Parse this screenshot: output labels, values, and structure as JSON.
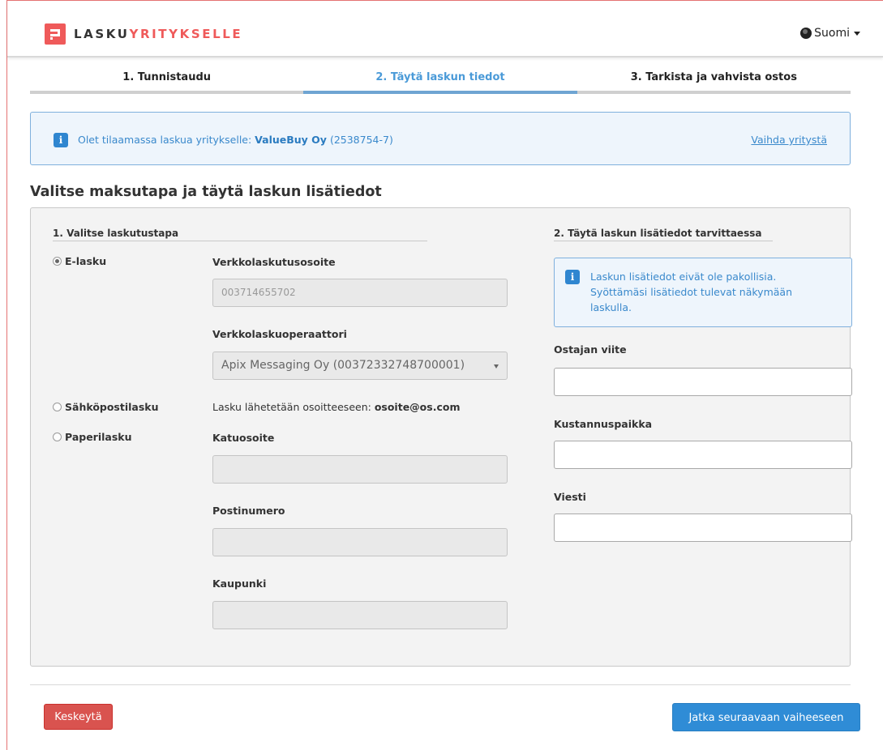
{
  "header": {
    "logo_part1": "LASKU",
    "logo_part2": "YRITYKSELLE",
    "language": "Suomi"
  },
  "steps": [
    {
      "label": "1. Tunnistaudu"
    },
    {
      "label": "2. Täytä laskun tiedot"
    },
    {
      "label": "3. Tarkista ja vahvista ostos"
    }
  ],
  "banner": {
    "prefix": "Olet tilaamassa laskua yritykselle: ",
    "company": "ValueBuy Oy",
    "company_id": " (2538754-7)",
    "change_link": "Vaihda yritystä"
  },
  "section_title": "Valitse maksutapa ja täytä laskun lisätiedot",
  "left": {
    "title": "1. Valitse laskutustapa",
    "options": [
      {
        "label": "E-lasku",
        "checked": true
      },
      {
        "label": "Sähköpostilasku",
        "checked": false
      },
      {
        "label": "Paperilasku",
        "checked": false
      }
    ],
    "einvoice_address_label": "Verkkolaskutusosoite",
    "einvoice_address_value": "003714655702",
    "operator_label": "Verkkolaskuoperaattori",
    "operator_value": "Apix Messaging Oy (00372332748700001)",
    "email_prefix": "Lasku lähetetään osoitteeseen: ",
    "email_value": "osoite@os.com",
    "street_label": "Katuosoite",
    "street_value": "",
    "postal_label": "Postinumero",
    "postal_value": "",
    "city_label": "Kaupunki",
    "city_value": ""
  },
  "right": {
    "title": "2. Täytä laskun lisätiedot tarvittaessa",
    "info_text": "Laskun lisätiedot eivät ole pakollisia. Syöttämäsi lisätiedot tulevat näkymään laskulla.",
    "buyer_ref_label": "Ostajan viite",
    "buyer_ref_value": "",
    "cost_center_label": "Kustannuspaikka",
    "cost_center_value": "",
    "message_label": "Viesti",
    "message_value": ""
  },
  "footer": {
    "cancel_label": "Keskeytä",
    "next_label": "Jatka seuraavaan vaiheeseen"
  },
  "colors": {
    "brand": "#ef5a5a",
    "accent": "#2f8cd6",
    "danger": "#d9534f"
  }
}
